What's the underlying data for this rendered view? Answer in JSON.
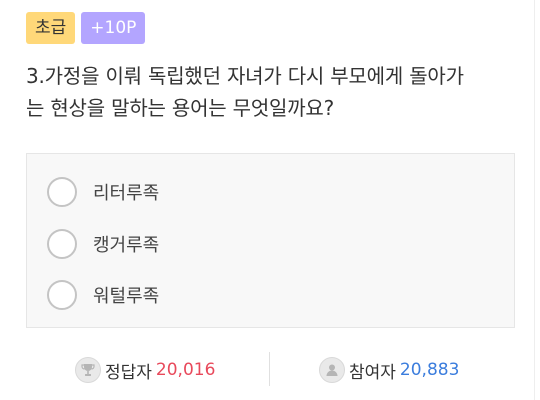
{
  "badges": {
    "level": "초급",
    "points": "+10P"
  },
  "question": {
    "line1": "3.가정을 이뤄 독립했던 자녀가 다시 부모에게 돌아가",
    "line2": "는 현상을 말하는 용어는 무엇일까요?"
  },
  "options": [
    {
      "label": "리터루족"
    },
    {
      "label": "캥거루족"
    },
    {
      "label": "워털루족"
    }
  ],
  "stats": {
    "correct_label": "정답자",
    "correct_value": "20,016",
    "participants_label": "참여자",
    "participants_value": "20,883"
  },
  "icons": {
    "correct": "trophy-icon",
    "participants": "person-icon"
  },
  "colors": {
    "level_badge": "#ffd879",
    "points_badge": "#b3a5ff",
    "correct_value": "#e8495b",
    "participants_value": "#3b7ddd"
  }
}
